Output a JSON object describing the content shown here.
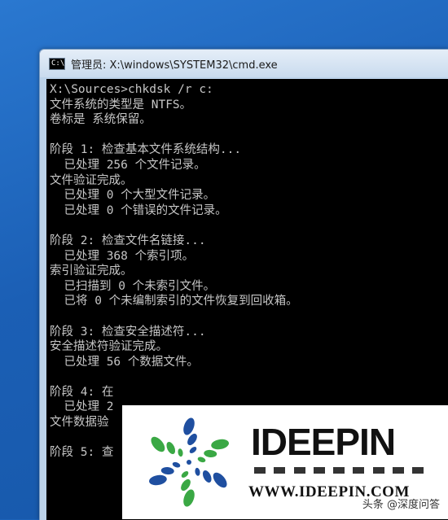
{
  "window": {
    "title": "管理员: X:\\windows\\SYSTEM32\\cmd.exe",
    "icon_text": "C:\\"
  },
  "console": {
    "lines": [
      "X:\\Sources>chkdsk /r c:",
      "文件系统的类型是 NTFS。",
      "卷标是 系统保留。",
      "",
      "阶段 1: 检查基本文件系统结构...",
      "  已处理 256 个文件记录。",
      "文件验证完成。",
      "  已处理 0 个大型文件记录。",
      "  已处理 0 个错误的文件记录。",
      "",
      "阶段 2: 检查文件名链接...",
      "  已处理 368 个索引项。",
      "索引验证完成。",
      "  已扫描到 0 个未索引文件。",
      "  已将 0 个未编制索引的文件恢复到回收箱。",
      "",
      "阶段 3: 检查安全描述符...",
      "安全描述符验证完成。",
      "  已处理 56 个数据文件。",
      "",
      "阶段 4: 在",
      "  已处理 2",
      "文件数据验",
      "",
      "阶段 5: 查"
    ]
  },
  "logo": {
    "brand": "IDEEPIN",
    "url": "WWW.IDEEPIN.COM",
    "watermark": "头条 @深度问答"
  },
  "colors": {
    "console_bg": "#000000",
    "console_text": "#c6c6c6",
    "logo_blue": "#1f4fa0",
    "logo_green": "#3aa844"
  }
}
